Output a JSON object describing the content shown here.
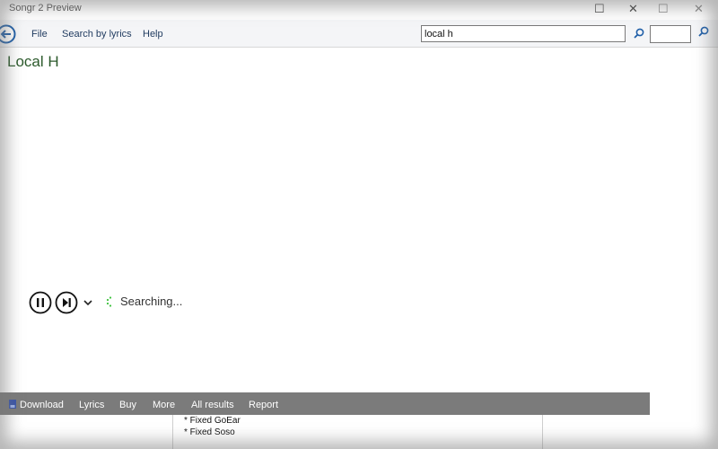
{
  "window": {
    "title": "Songr 2 Preview",
    "minimize_glyph": "—",
    "maximize_glyph": "☐",
    "close_glyph": "✕"
  },
  "menu": {
    "file": "File",
    "search_by_lyrics": "Search by lyrics",
    "help": "Help"
  },
  "search": {
    "value": "local h"
  },
  "song": {
    "title": "Local H"
  },
  "player": {
    "status": "Searching..."
  },
  "bottom_bar": {
    "items": [
      "Download",
      "Lyrics",
      "Buy",
      "More",
      "All results",
      "Report"
    ]
  },
  "changelog": {
    "lines": [
      "* Fixed GoEar",
      "* Fixed Soso"
    ]
  },
  "colors": {
    "accent": "#1f5fa8",
    "title_green": "#2c5a2c",
    "bottom_bar": "#7b7b7b",
    "spinner": "#3cc23c"
  },
  "icons": {
    "back": "back-arrow-icon",
    "search": "search-icon",
    "pause": "pause-icon",
    "next": "skip-next-icon",
    "expand": "chevron-down-icon",
    "download": "download-icon",
    "spinner": "loading-spinner-icon"
  }
}
